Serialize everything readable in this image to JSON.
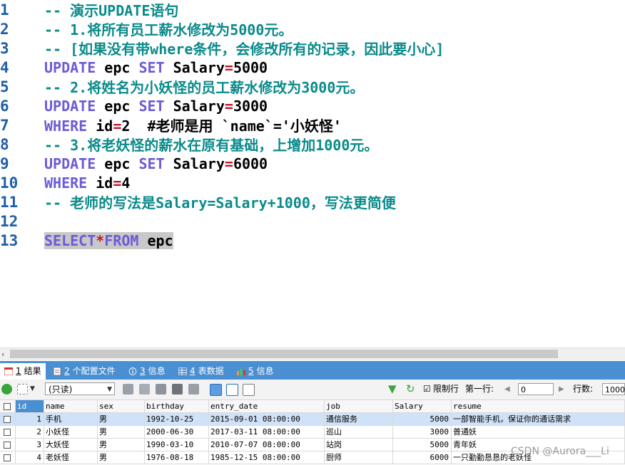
{
  "editor": {
    "lines": [
      {
        "n": "1",
        "t": "-- 演示UPDATE语句"
      },
      {
        "n": "2",
        "t": "-- 1.将所有员工薪水修改为5000元。"
      },
      {
        "n": "3",
        "t": "-- [如果没有带where条件，会修改所有的记录，因此要小心]"
      },
      {
        "n": "4",
        "a": "UPDATE",
        "b": " epc ",
        "c": "SET",
        "d": " Salary",
        "e": "=",
        "f": "5000"
      },
      {
        "n": "5",
        "t": "-- 2.将姓名为小妖怪的员工薪水修改为3000元。"
      },
      {
        "n": "6",
        "a": "UPDATE",
        "b": " epc ",
        "c": "SET",
        "d": " Salary",
        "e": "=",
        "f": "3000"
      },
      {
        "n": "7",
        "a": "WHERE",
        "b": " id",
        "e": "=",
        "f": "2  #老师是用 `name`='小妖怪'"
      },
      {
        "n": "8",
        "t": "-- 3.将老妖怪的薪水在原有基础，上增加1000元。"
      },
      {
        "n": "9",
        "a": "UPDATE",
        "b": " epc ",
        "c": "SET",
        "d": " Salary",
        "e": "=",
        "f": "6000"
      },
      {
        "n": "10",
        "a": "WHERE",
        "b": " id",
        "e": "=",
        "f": "4"
      },
      {
        "n": "11",
        "t": "-- 老师的写法是Salary=Salary+1000，写法更简便"
      },
      {
        "n": "12"
      },
      {
        "n": "13",
        "a": "SELECT",
        "e": "*",
        "c": "FROM",
        "b": " epc"
      }
    ]
  },
  "tabs": [
    {
      "num": "1",
      "label": "结果"
    },
    {
      "num": "2",
      "label": "个配置文件"
    },
    {
      "num": "3",
      "label": "信息"
    },
    {
      "num": "4",
      "label": "表数据"
    },
    {
      "num": "5",
      "label": "信息"
    }
  ],
  "toolbar": {
    "mode_select": "(只读)",
    "limit_rows_label": "限制行",
    "first_row_label": "第一行:",
    "first_row_value": "0",
    "row_count_label": "行数:",
    "row_count_value": "1000"
  },
  "grid": {
    "columns": [
      "id",
      "name",
      "sex",
      "birthday",
      "entry_date",
      "job",
      "Salary",
      "resume"
    ],
    "rows": [
      [
        "1",
        "手机",
        "男",
        "1992-10-25",
        "2015-09-01 08:00:00",
        "通信服务",
        "5000",
        "一部智能手机，保证你的通话需求"
      ],
      [
        "2",
        "小妖怪",
        "男",
        "2000-06-30",
        "2017-03-11 08:00:00",
        "巡山",
        "3000",
        "普通妖"
      ],
      [
        "3",
        "大妖怪",
        "男",
        "1990-03-10",
        "2010-07-07 08:00:00",
        "站岗",
        "5000",
        "青年妖"
      ],
      [
        "4",
        "老妖怪",
        "男",
        "1976-08-18",
        "1985-12-15 08:00:00",
        "厨师",
        "6000",
        "一只勤勤恳恳的老妖怪"
      ]
    ]
  },
  "watermark": "CSDN @Aurora___Li",
  "colors": {
    "comment": "#0a8a8a",
    "keyword": "#6b5bd6",
    "operator": "#c0152a",
    "tab_bar": "#4a8fd1",
    "row_highlight": "#cfe2f7"
  }
}
